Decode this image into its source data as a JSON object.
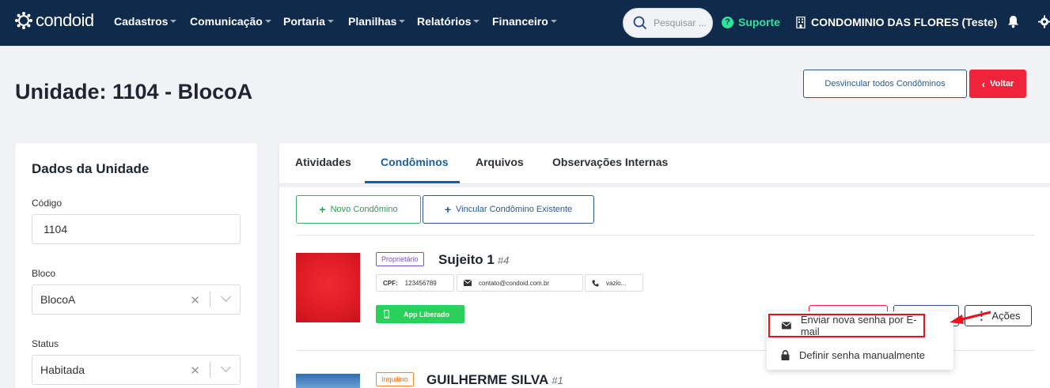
{
  "app": {
    "logo_text": "condoid"
  },
  "nav": {
    "items": [
      {
        "label": "Cadastros"
      },
      {
        "label": "Comunicação"
      },
      {
        "label": "Portaria"
      },
      {
        "label": "Planilhas"
      },
      {
        "label": "Relatórios"
      },
      {
        "label": "Financeiro"
      }
    ],
    "search_placeholder": "Pesquisar ...",
    "support_label": "Suporte",
    "condo_label": "CONDOMINIO DAS FLORES (Teste)"
  },
  "header": {
    "title": "Unidade: 1104 - BlocoA",
    "unlink_button": "Desvincular todos Condôminos",
    "back_button": "Voltar"
  },
  "unit_card": {
    "title": "Dados da Unidade",
    "code_label": "Código",
    "code_value": "1104",
    "block_label": "Bloco",
    "block_value": "BlocoA",
    "status_label": "Status",
    "status_value": "Habitada"
  },
  "tabs": [
    {
      "label": "Atividades"
    },
    {
      "label": "Condôminos"
    },
    {
      "label": "Arquivos"
    },
    {
      "label": "Observações Internas"
    }
  ],
  "actions": {
    "new_resident": "Novo Condômino",
    "link_existing": "Vincular Condômino Existente"
  },
  "residents": [
    {
      "role": "Proprietário",
      "name": "Sujeito 1",
      "id": "#4",
      "cpf_label": "CPF:",
      "cpf": "123456789",
      "email": "contato@condoid.com.br",
      "phone": "vazio...",
      "app_status": "App Liberado",
      "actions_label": "Ações"
    },
    {
      "role": "Inquilino",
      "name": "GUILHERME SILVA",
      "id": "#1"
    }
  ],
  "dropdown": {
    "items": [
      {
        "label": "Enviar nova senha por E-mail",
        "icon": "envelope-icon"
      },
      {
        "label": "Definir senha manualmente",
        "icon": "lock-icon"
      }
    ]
  },
  "colors": {
    "nav_bg": "#0f2a4a",
    "accent_blue": "#1d5f9a",
    "danger": "#f0233d",
    "success": "#2bd05a",
    "support": "#2fe39a",
    "highlight": "#e8121e"
  }
}
